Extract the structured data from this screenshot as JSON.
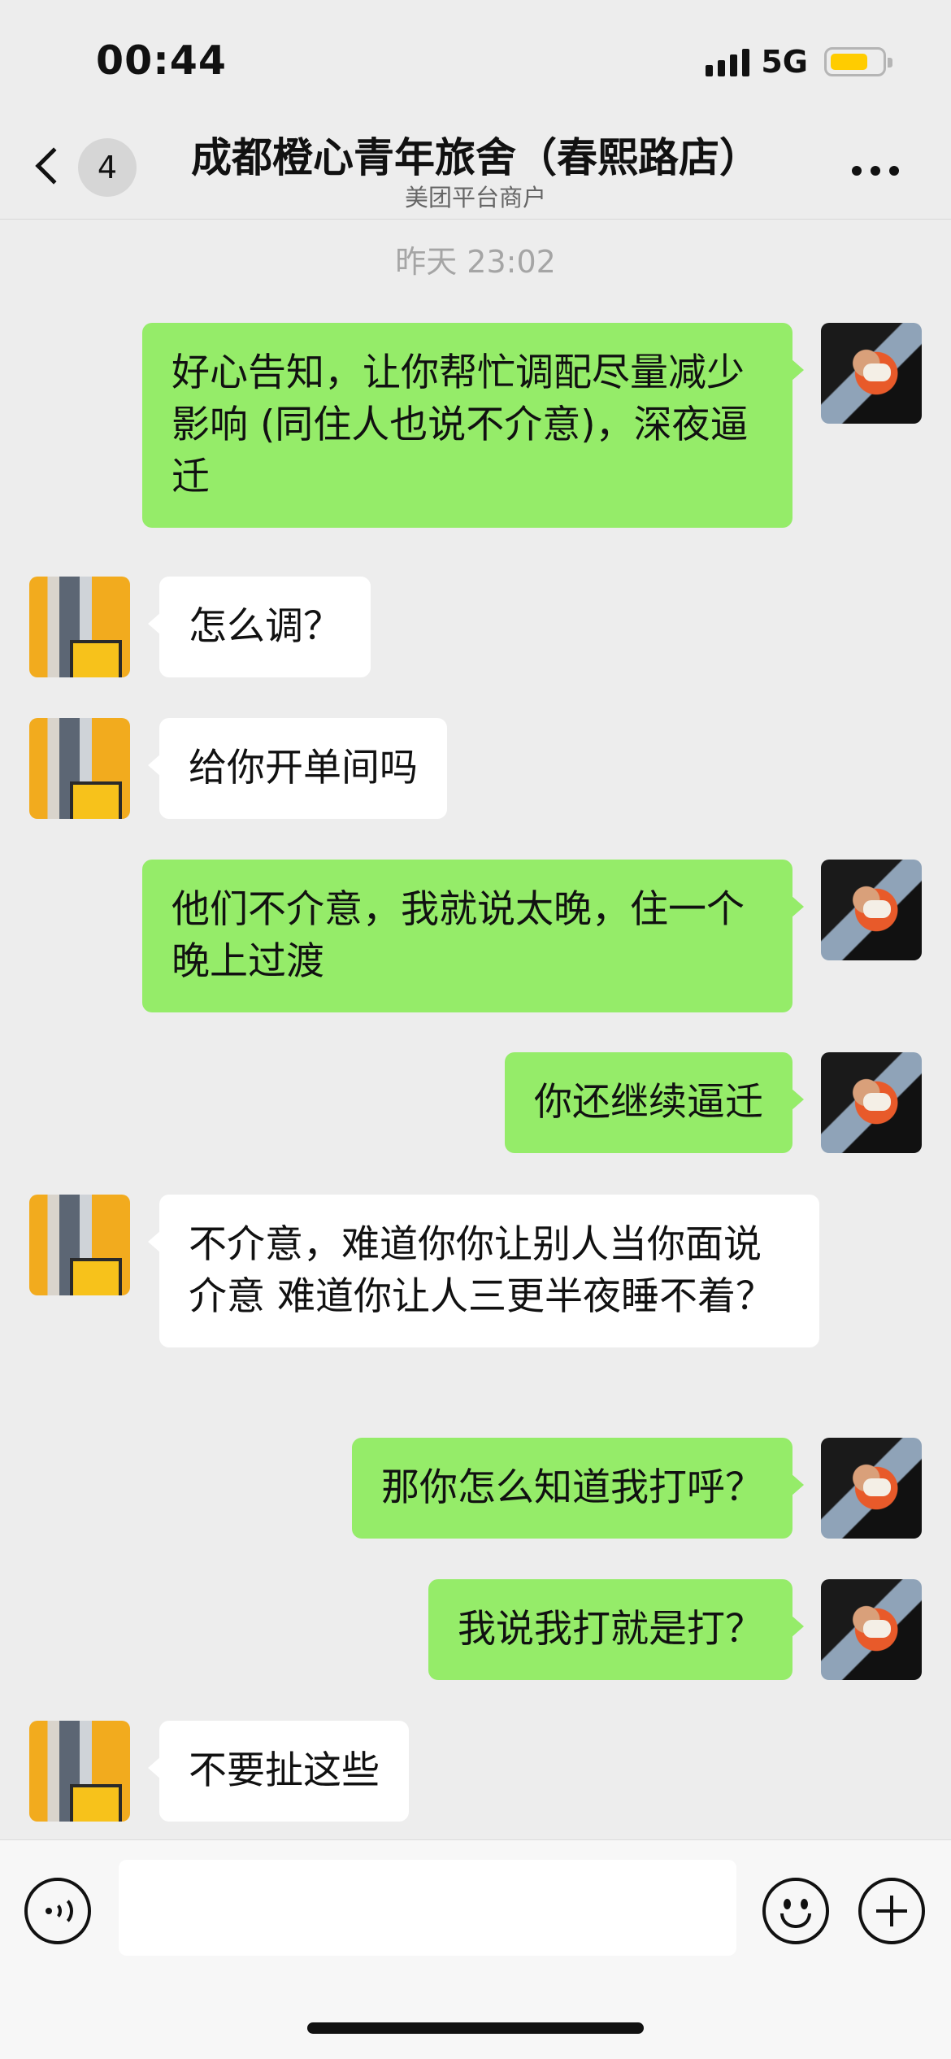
{
  "status_bar": {
    "time": "00:44",
    "network": "5G",
    "battery_level": 0.75,
    "battery_color": "#ffcc00"
  },
  "header": {
    "unread_count": "4",
    "title": "成都橙心青年旅舍（春熙路店）",
    "subtitle": "美团平台商户"
  },
  "chat": {
    "timestamp": "昨天 23:02",
    "messages": [
      {
        "from": "me",
        "text": "好心告知，让你帮忙调配尽量减少影响 (同住人也说不介意)，深夜逼迁"
      },
      {
        "from": "merchant",
        "text": "怎么调？"
      },
      {
        "from": "merchant",
        "text": "给你开单间吗"
      },
      {
        "from": "me",
        "text": "他们不介意，我就说太晚，住一个晚上过渡"
      },
      {
        "from": "me",
        "text": "你还继续逼迁"
      },
      {
        "from": "merchant",
        "text": "不介意，难道你你让别人当你面说介意 难道你让人三更半夜睡不着？"
      },
      {
        "from": "me",
        "text": "那你怎么知道我打呼？"
      },
      {
        "from": "me",
        "text": "我说我打就是打？"
      },
      {
        "from": "merchant",
        "text": "不要扯这些"
      }
    ]
  },
  "input_bar": {
    "message_value": "",
    "message_placeholder": ""
  },
  "colors": {
    "outgoing_bubble": "#95ec69",
    "incoming_bubble": "#ffffff",
    "background": "#ededed"
  },
  "icons": [
    "chevron-left-icon",
    "more-icon",
    "voice-icon",
    "emoji-icon",
    "plus-icon",
    "signal-icon",
    "battery-icon"
  ]
}
